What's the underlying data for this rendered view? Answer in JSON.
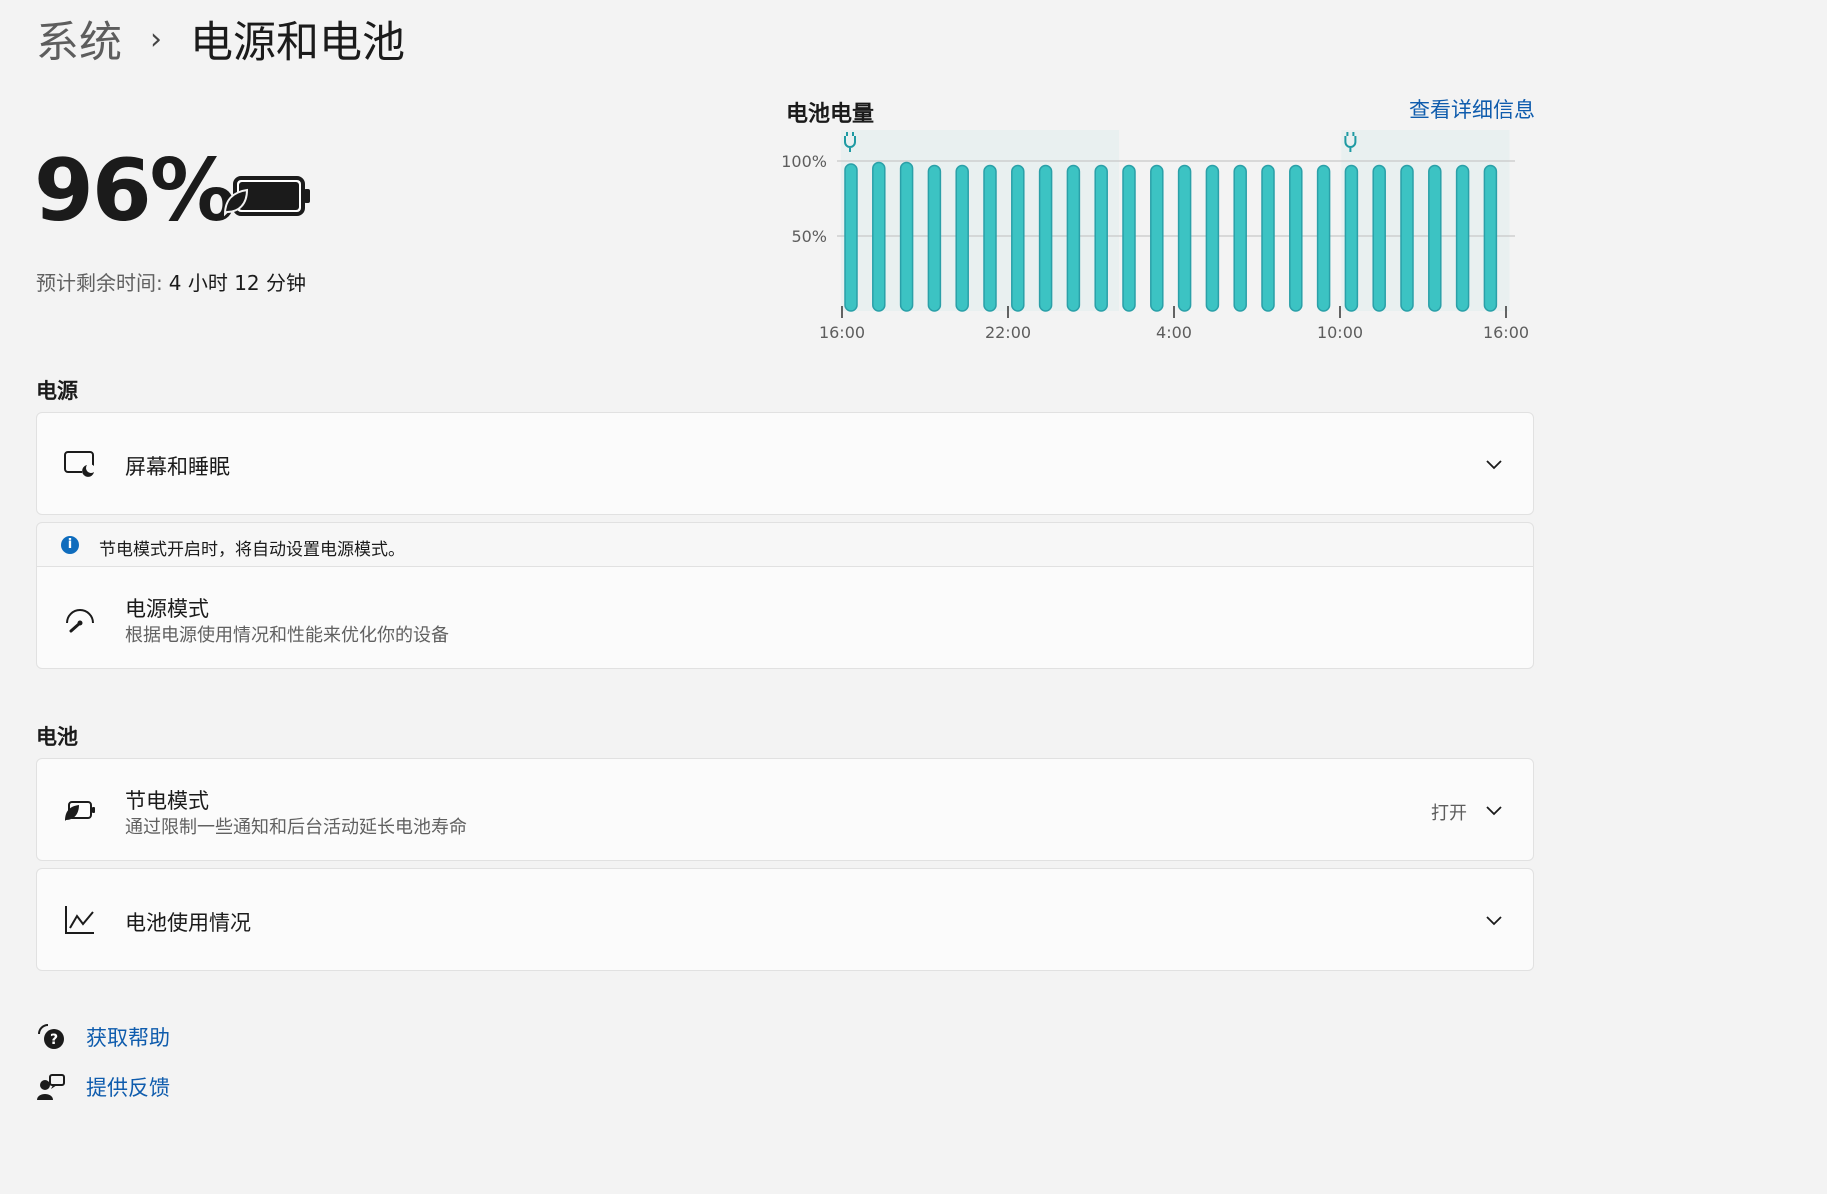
{
  "breadcrumb": {
    "parent": "系统",
    "separator": "›",
    "current": "电源和电池"
  },
  "battery": {
    "percent": "96%",
    "remaining_label": "预计剩余时间:",
    "remaining_value": "4 小时 12 分钟",
    "icon": "battery-saver-leaf-icon"
  },
  "chart": {
    "title": "电池电量",
    "details_link": "查看详细信息"
  },
  "chart_data": {
    "type": "bar",
    "title": "电池电量",
    "yticks": [
      "100%",
      "50%"
    ],
    "xticks": [
      "16:00",
      "22:00",
      "4:00",
      "10:00",
      "16:00"
    ],
    "ylim": [
      0,
      100
    ],
    "values": [
      98,
      99,
      99,
      97,
      97,
      97,
      97,
      97,
      97,
      97,
      97,
      97,
      97,
      97,
      97,
      97,
      97,
      97,
      97,
      97,
      97,
      97,
      97,
      97
    ],
    "charging_markers": [
      0,
      18
    ],
    "bar_color": "#3cc3c3",
    "grid": true
  },
  "sections": {
    "power": "电源",
    "battery": "电池"
  },
  "cards": {
    "screen_sleep": {
      "title": "屏幕和睡眠",
      "icon": "screen-sleep-icon"
    },
    "info_message": "节电模式开启时，将自动设置电源模式。",
    "power_mode": {
      "title": "电源模式",
      "subtitle": "根据电源使用情况和性能来优化你的设备",
      "icon": "gauge-icon"
    },
    "battery_saver": {
      "title": "节电模式",
      "subtitle": "通过限制一些通知和后台活动延长电池寿命",
      "state": "打开",
      "icon": "battery-saver-icon"
    },
    "battery_usage": {
      "title": "电池使用情况",
      "icon": "line-chart-icon"
    }
  },
  "footer": {
    "help": "获取帮助",
    "feedback": "提供反馈"
  },
  "colors": {
    "accent": "#0f5cad",
    "bar": "#3cc3c3",
    "background": "#f3f3f3"
  }
}
